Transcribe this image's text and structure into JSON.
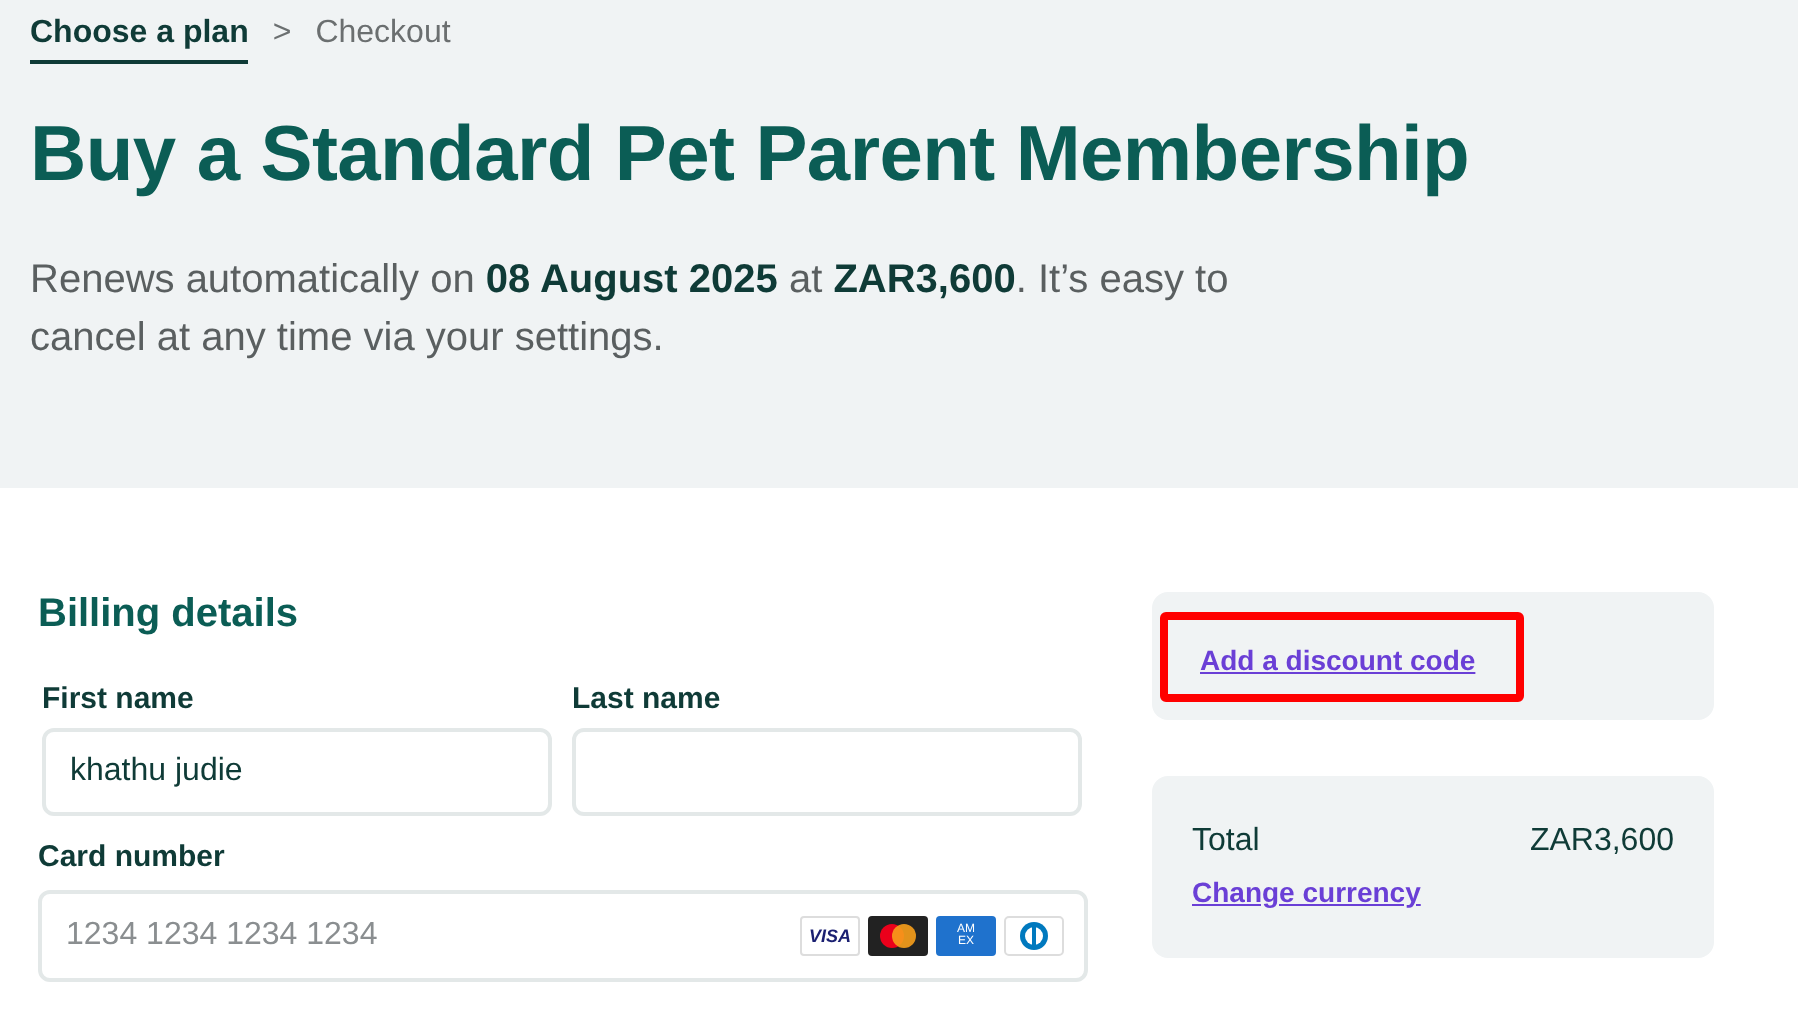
{
  "breadcrumb": [
    {
      "label": "Choose a plan",
      "selected": true
    },
    {
      "label": "Checkout",
      "selected": false
    }
  ],
  "breadcrumb_separator": ">",
  "title": "Buy a Standard Pet Parent Membership",
  "subtitle": "Renews automatically on **08 August 2025** at **ZAR3,600**. It’s easy to cancel at any time via your settings.",
  "billing": {
    "heading": "Billing details",
    "first_name": {
      "label": "First name",
      "value": "khathu judie"
    },
    "last_name": {
      "label": "Last name"
    },
    "card_number": {
      "label": "Card number",
      "placeholder": "1234 1234 1234 1234"
    },
    "card_brands": [
      {
        "kind": "visa",
        "label": "VISA"
      },
      {
        "kind": "mastercard"
      },
      {
        "kind": "amex",
        "label": "AM EX"
      },
      {
        "kind": "diners"
      }
    ]
  },
  "discount": {
    "link": "Add a discount code",
    "highlighted": true
  },
  "summary": {
    "total_label": "Total",
    "total_value": "ZAR3,600",
    "currency_link": "Change currency"
  }
}
